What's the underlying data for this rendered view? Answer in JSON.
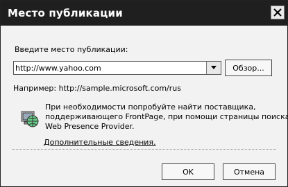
{
  "dialog": {
    "title": "Место публикации",
    "label": "Введите место публикации:",
    "location_value": "http://www.yahoo.com",
    "browse_label": "Обзор...",
    "example_text": "Например: http://sample.microsoft.com/rus",
    "hint_lines": [
      "При необходимости попробуйте найти поставщика,",
      "поддерживающего FrontPage, при помощи страницы поиска",
      "Web Presence Provider."
    ],
    "more_info_link": "Дополнительные сведения.",
    "ok_label": "OK",
    "cancel_label": "Отмена"
  },
  "icons": {
    "close": "close-icon",
    "dropdown": "chevron-down-icon",
    "hint": "globe-computer-icon"
  }
}
